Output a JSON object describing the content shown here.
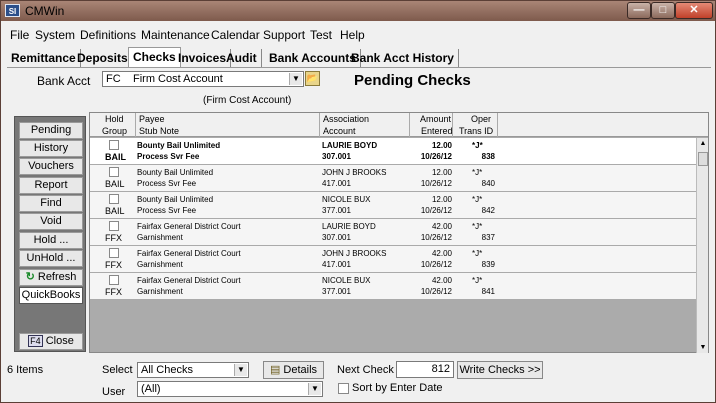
{
  "app": {
    "icon_text": "SI",
    "title": "CMWin"
  },
  "window_controls": {
    "minimize": "—",
    "maximize": "□",
    "close": "✕"
  },
  "menu": [
    "File",
    "System",
    "Definitions",
    "Maintenance",
    "Calendar",
    "Support",
    "Test",
    "Help"
  ],
  "tabs": [
    "Remittance",
    "Deposits",
    "Checks",
    "Invoices",
    "Audit",
    "Bank Accounts",
    "Bank Acct History"
  ],
  "active_tab": "Checks",
  "bank_acct": {
    "label": "Bank Acct",
    "code": "FC",
    "name": "Firm Cost Account",
    "caption": "(Firm Cost Account)"
  },
  "page_title": "Pending Checks",
  "sidebar": {
    "buttons": [
      "Pending",
      "History",
      "Vouchers",
      "Report",
      "Find",
      "Void",
      "Hold ...",
      "UnHold ..."
    ],
    "refresh": "Refresh",
    "quickbooks": "QuickBooks",
    "close_key": "F4",
    "close": "Close"
  },
  "grid": {
    "headers": {
      "hold": "Hold",
      "group": "Group",
      "payee": "Payee",
      "stub_note": "Stub Note",
      "association": "Association",
      "account": "Account",
      "amount": "Amount",
      "entered": "Entered",
      "oper": "Oper",
      "trans_id": "Trans ID"
    },
    "rows": [
      {
        "group": "BAIL",
        "payee": "Bounty Bail Unlimited",
        "stub_note": "Process Svr Fee",
        "association": "LAURIE BOYD",
        "account": "307.001",
        "amount": "12.00",
        "entered": "10/26/12",
        "oper": "*J*",
        "trans_id": "838"
      },
      {
        "group": "BAIL",
        "payee": "Bounty Bail Unlimited",
        "stub_note": "Process Svr Fee",
        "association": "JOHN J BROOKS",
        "account": "417.001",
        "amount": "12.00",
        "entered": "10/26/12",
        "oper": "*J*",
        "trans_id": "840"
      },
      {
        "group": "BAIL",
        "payee": "Bounty Bail Unlimited",
        "stub_note": "Process Svr Fee",
        "association": "NICOLE BUX",
        "account": "377.001",
        "amount": "12.00",
        "entered": "10/26/12",
        "oper": "*J*",
        "trans_id": "842"
      },
      {
        "group": "FFX",
        "payee": "Fairfax General District Court",
        "stub_note": "Garnishment",
        "association": "LAURIE BOYD",
        "account": "307.001",
        "amount": "42.00",
        "entered": "10/26/12",
        "oper": "*J*",
        "trans_id": "837"
      },
      {
        "group": "FFX",
        "payee": "Fairfax General District Court",
        "stub_note": "Garnishment",
        "association": "JOHN J BROOKS",
        "account": "417.001",
        "amount": "42.00",
        "entered": "10/26/12",
        "oper": "*J*",
        "trans_id": "839"
      },
      {
        "group": "FFX",
        "payee": "Fairfax General District Court",
        "stub_note": "Garnishment",
        "association": "NICOLE BUX",
        "account": "377.001",
        "amount": "42.00",
        "entered": "10/26/12",
        "oper": "*J*",
        "trans_id": "841"
      }
    ]
  },
  "footer": {
    "items_count": "6 Items",
    "select_label": "Select",
    "select_value": "All Checks",
    "user_label": "User",
    "user_value": "(All)",
    "details": "Details",
    "next_check_label": "Next Check #",
    "next_check_value": "812",
    "write_checks": "Write Checks >>",
    "sort_label": "Sort by Enter Date"
  }
}
